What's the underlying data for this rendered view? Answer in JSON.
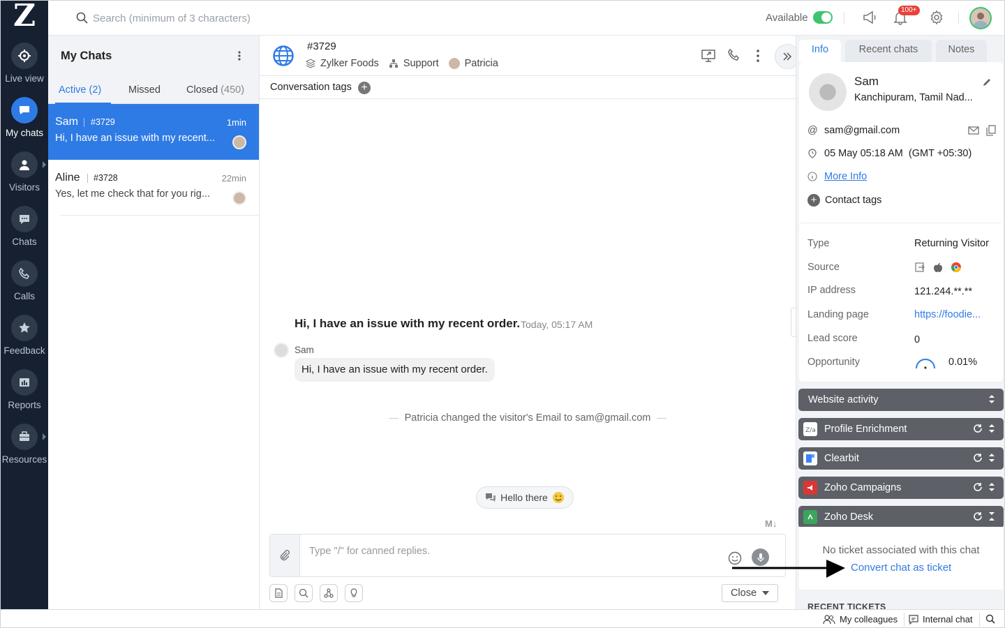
{
  "nav": {
    "logo": "Z",
    "items": [
      {
        "label": "Live view",
        "icon": "crosshair-icon"
      },
      {
        "label": "My chats",
        "icon": "chat-bubble-icon"
      },
      {
        "label": "Visitors",
        "icon": "person-icon"
      },
      {
        "label": "Chats",
        "icon": "speech-icon"
      },
      {
        "label": "Calls",
        "icon": "phone-icon"
      },
      {
        "label": "Feedback",
        "icon": "star-icon"
      },
      {
        "label": "Reports",
        "icon": "bar-chart-icon"
      },
      {
        "label": "Resources",
        "icon": "briefcase-icon"
      }
    ]
  },
  "topbar": {
    "search_placeholder": "Search (minimum of 3 characters)",
    "status_label": "Available",
    "notification_count": "100+"
  },
  "chatlist": {
    "title": "My Chats",
    "tabs": [
      {
        "label": "Active",
        "count": "(2)"
      },
      {
        "label": "Missed",
        "count": ""
      },
      {
        "label": "Closed",
        "count": "(450)"
      }
    ],
    "items": [
      {
        "name": "Sam",
        "id": "#3729",
        "time": "1min",
        "message": "Hi, I have an issue with my recent..."
      },
      {
        "name": "Aline",
        "id": "#3728",
        "time": "22min",
        "message": "Yes, let me check that for you rig..."
      }
    ]
  },
  "conversation": {
    "id": "#3729",
    "brand": "Zylker Foods",
    "department": "Support",
    "operator": "Patricia",
    "tags_label": "Conversation tags",
    "question": "Hi, I have an issue with my recent order.",
    "question_time": "Today, 05:17 AM",
    "sender": "Sam",
    "message": "Hi, I have an issue with my recent order.",
    "system_message": "Patricia changed the visitor's Email to sam@gmail.com",
    "suggestion": "Hello there",
    "markdown_badge": "M↓",
    "composer_placeholder": "Type \"/\" for canned replies.",
    "close_label": "Close"
  },
  "info": {
    "tabs": [
      "Info",
      "Recent chats",
      "Notes"
    ],
    "name": "Sam",
    "location": "Kanchipuram, Tamil Nad...",
    "email": "sam@gmail.com",
    "datetime": "05 May 05:18 AM  (GMT +05:30)",
    "more_info": "More Info",
    "contact_tags": "Contact tags",
    "details": [
      {
        "label": "Type",
        "value": "Returning Visitor"
      },
      {
        "label": "Source",
        "value": ""
      },
      {
        "label": "IP address",
        "value": "121.244.**.**"
      },
      {
        "label": "Landing page",
        "value": "https://foodie..."
      },
      {
        "label": "Lead score",
        "value": "0"
      },
      {
        "label": "Opportunity",
        "value": "0.01%"
      }
    ],
    "sections": [
      "Website activity",
      "Profile Enrichment",
      "Clearbit",
      "Zoho Campaigns",
      "Zoho Desk"
    ],
    "no_ticket": "No ticket associated with this chat",
    "convert_link": "Convert chat as ticket",
    "recent_tickets": "RECENT TICKETS"
  },
  "bottombar": {
    "colleagues": "My colleagues",
    "internal_chat": "Internal chat"
  },
  "colors": {
    "accent": "#2f7be5",
    "nav_bg": "#162031",
    "online": "#3ec46d",
    "badge": "#e8433a"
  }
}
